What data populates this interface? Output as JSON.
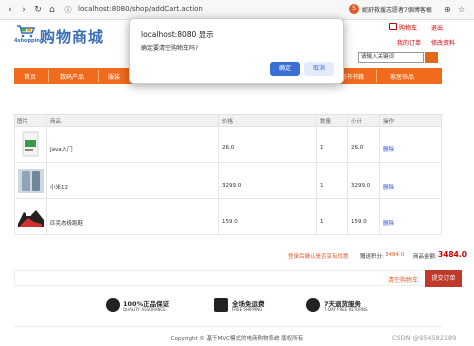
{
  "browser": {
    "url": "localhost:8080/shop/addCart.action",
    "bookmark_badge": "S",
    "bookmark_text": "妮舒救援志愿者7個博客根"
  },
  "site": {
    "logo_en": "4shopping",
    "logo_cn": "购物商城",
    "header_links": [
      "购物车",
      "退出",
      "我的订单",
      "修改资料"
    ],
    "search_placeholder": "请输入关键词"
  },
  "nav": {
    "items": [
      "首页",
      "数码产品",
      "服装",
      "图书书籍",
      "家居饰品"
    ]
  },
  "dialog": {
    "title": "localhost:8080 显示",
    "message": "确定要清空购物车吗?",
    "ok": "确定",
    "cancel": "取消"
  },
  "cart": {
    "headers": [
      "图片",
      "商品",
      "价格",
      "数量",
      "小计",
      "操作"
    ],
    "rows": [
      {
        "name": "Java入门",
        "price": "26.0",
        "qty": "1",
        "subtotal": "26.0",
        "action": "删除"
      },
      {
        "name": "小米12",
        "price": "3299.0",
        "qty": "1",
        "subtotal": "3299.0",
        "action": "删除"
      },
      {
        "name": "匹克态极跑鞋",
        "price": "159.0",
        "qty": "1",
        "subtotal": "159.0",
        "action": "删除"
      }
    ],
    "login_hint": "登录后确认是否享有优惠",
    "points_label": "赠送积分:",
    "points_value": "3484.0",
    "total_label": "商品金额:",
    "total_value": "3484.0",
    "clear_link": "清空购物车",
    "checkout": "提交订单"
  },
  "features": [
    {
      "title": "100%正品保证",
      "sub": "QUALITY ASSURANCE"
    },
    {
      "title": "全场免运费",
      "sub": "FREE SHIPPING"
    },
    {
      "title": "7天退货服务",
      "sub": "7-DAY FREE RETURNS"
    }
  ],
  "footer": {
    "copyright": "Copyright © 基于MVC模式的电商购物系统 版权所有",
    "watermark": "CSDN @954582189"
  },
  "colors": {
    "accent": "#f26a1b",
    "checkout": "#c0392b",
    "link": "#2a4bd7",
    "logo": "#3a6fb5"
  }
}
